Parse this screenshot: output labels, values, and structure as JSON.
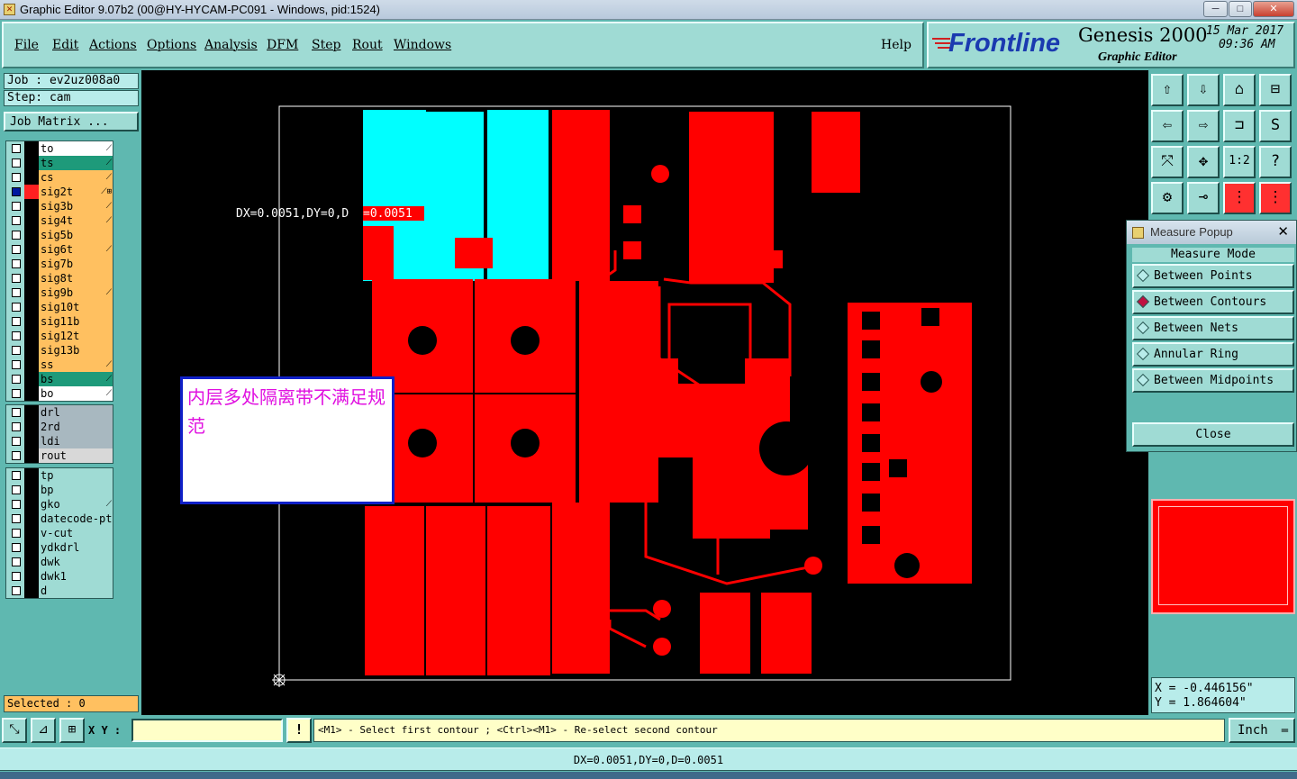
{
  "window": {
    "title": "Graphic Editor 9.07b2 (00@HY-HYCAM-PC091 - Windows, pid:1524)",
    "min_label": "─",
    "max_label": "□",
    "close_label": "✕"
  },
  "menu": {
    "items": [
      "File",
      "Edit",
      "Actions",
      "Options",
      "Analysis",
      "DFM",
      "Step",
      "Rout",
      "Windows"
    ],
    "help": "Help"
  },
  "brand": {
    "logo": "Frontline",
    "product": "Genesis 2000",
    "subtitle": "Graphic Editor",
    "date": "15 Mar 2017",
    "time": "09:36 AM"
  },
  "job": {
    "job_label": "Job : ev2uz008a0",
    "step_label": "Step: cam",
    "matrix_button": "Job Matrix ..."
  },
  "layers": {
    "group1": [
      {
        "name": "to",
        "color": "#ffffff",
        "glyph": "⟋"
      },
      {
        "name": "ts",
        "color": "#1e9a7a",
        "glyph": "⟋"
      },
      {
        "name": "cs",
        "color": "#ffc060",
        "glyph": "⟋"
      },
      {
        "name": "sig2t",
        "color": "#ffc060",
        "glyph": "⟋⊞",
        "selected": true
      },
      {
        "name": "sig3b",
        "color": "#ffc060",
        "glyph": "⟋"
      },
      {
        "name": "sig4t",
        "color": "#ffc060",
        "glyph": "⟋"
      },
      {
        "name": "sig5b",
        "color": "#ffc060",
        "glyph": ""
      },
      {
        "name": "sig6t",
        "color": "#ffc060",
        "glyph": "⟋"
      },
      {
        "name": "sig7b",
        "color": "#ffc060",
        "glyph": ""
      },
      {
        "name": "sig8t",
        "color": "#ffc060",
        "glyph": ""
      },
      {
        "name": "sig9b",
        "color": "#ffc060",
        "glyph": "⟋"
      },
      {
        "name": "sig10t",
        "color": "#ffc060",
        "glyph": ""
      },
      {
        "name": "sig11b",
        "color": "#ffc060",
        "glyph": ""
      },
      {
        "name": "sig12t",
        "color": "#ffc060",
        "glyph": ""
      },
      {
        "name": "sig13b",
        "color": "#ffc060",
        "glyph": ""
      },
      {
        "name": "ss",
        "color": "#ffc060",
        "glyph": "⟋"
      },
      {
        "name": "bs",
        "color": "#1e9a7a",
        "glyph": "⟋"
      },
      {
        "name": "bo",
        "color": "#ffffff",
        "glyph": "⟋"
      }
    ],
    "group2": [
      {
        "name": "drl",
        "color": "#a8b8c0",
        "glyph": ""
      },
      {
        "name": "2rd",
        "color": "#a8b8c0",
        "glyph": ""
      },
      {
        "name": "ldi",
        "color": "#a8b8c0",
        "glyph": ""
      },
      {
        "name": "rout",
        "color": "#d8d8d8",
        "glyph": ""
      }
    ],
    "group3": [
      {
        "name": "tp",
        "color": "#9fdbd4",
        "glyph": ""
      },
      {
        "name": "bp",
        "color": "#9fdbd4",
        "glyph": ""
      },
      {
        "name": "gko",
        "color": "#9fdbd4",
        "glyph": "⟋"
      },
      {
        "name": "datecode-pt",
        "color": "#9fdbd4",
        "glyph": ""
      },
      {
        "name": "v-cut",
        "color": "#9fdbd4",
        "glyph": ""
      },
      {
        "name": "ydkdrl",
        "color": "#9fdbd4",
        "glyph": ""
      },
      {
        "name": "dwk",
        "color": "#9fdbd4",
        "glyph": ""
      },
      {
        "name": "dwk1",
        "color": "#9fdbd4",
        "glyph": ""
      },
      {
        "name": "d",
        "color": "#9fdbd4",
        "glyph": ""
      }
    ],
    "selected_count": "Selected : 0"
  },
  "canvas": {
    "measure_prefix": "DX=0.0051,DY=0,D",
    "measure_value": "=0.0051",
    "note_text": "内层多处隔离带不满足规范",
    "copper_color": "#ff0000",
    "highlight_color": "#00ffff"
  },
  "tools": [
    {
      "icon": "pan-up-icon",
      "glyph": "⇧"
    },
    {
      "icon": "pan-down-icon",
      "glyph": "⇩"
    },
    {
      "icon": "home-view-icon",
      "glyph": "⌂"
    },
    {
      "icon": "window-split-icon",
      "glyph": "⊟"
    },
    {
      "icon": "pan-left-icon",
      "glyph": "⇦"
    },
    {
      "icon": "pan-right-icon",
      "glyph": "⇨"
    },
    {
      "icon": "zoom-fit-icon",
      "glyph": "⊐"
    },
    {
      "icon": "redraw-icon",
      "glyph": "S"
    },
    {
      "icon": "zoom-extents-icon",
      "glyph": "⤧"
    },
    {
      "icon": "zoom-center-icon",
      "glyph": "✥"
    },
    {
      "icon": "scale-1-2-icon",
      "glyph": "1:2"
    },
    {
      "icon": "help-icon",
      "glyph": "?"
    },
    {
      "icon": "settings-icon",
      "glyph": "⚙"
    },
    {
      "icon": "snap-icon",
      "glyph": "⊸"
    },
    {
      "icon": "net-display-icon",
      "glyph": "⋮"
    },
    {
      "icon": "net-highlight-icon",
      "glyph": "⋮"
    }
  ],
  "measure_popup": {
    "title": "Measure Popup",
    "mode_label": "Measure Mode",
    "options": [
      "Between Points",
      "Between Contours",
      "Between Nets",
      "Annular Ring",
      "Between Midpoints"
    ],
    "selected_index": 1,
    "close_label": "Close"
  },
  "coords": {
    "x_label": "X = -0.446156\"",
    "y_label": "Y = 1.864604\""
  },
  "bottom": {
    "xy_label": "X Y :",
    "xy_value": "",
    "warn_glyph": "!",
    "prompt": "<M1> - Select first contour ; <Ctrl><M1> - Re-select second contour",
    "units": "Inch",
    "units_glyph": "═"
  },
  "status": {
    "text": "DX=0.0051,DY=0,D=0.0051"
  }
}
